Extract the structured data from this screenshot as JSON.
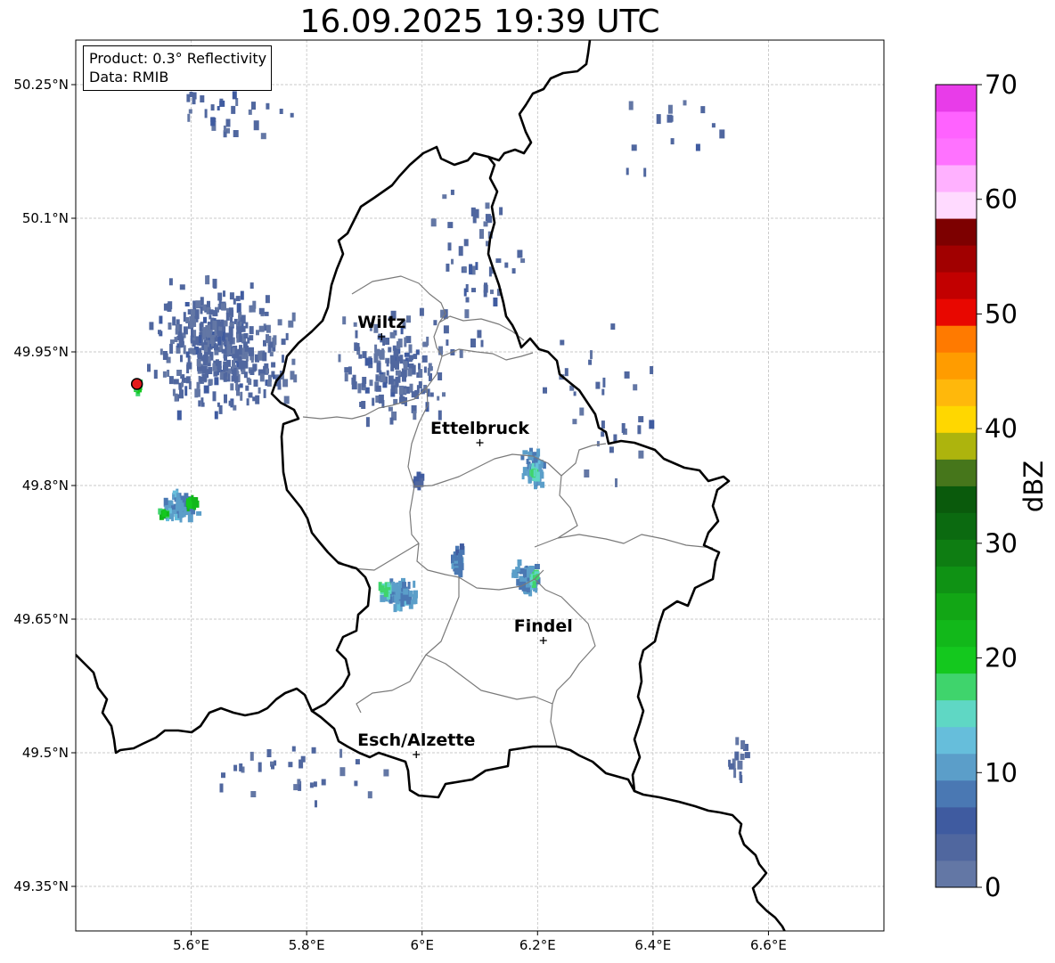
{
  "title": "16.09.2025 19:39 UTC",
  "info_box": {
    "product_line": "Product: 0.3° Reflectivity",
    "data_line": "Data: RMIB"
  },
  "map": {
    "lon_range": [
      5.4,
      6.8
    ],
    "lat_range": [
      49.3,
      50.3
    ],
    "lon_ticks": [
      {
        "value": 5.6,
        "label": "5.6°E"
      },
      {
        "value": 5.8,
        "label": "5.8°E"
      },
      {
        "value": 6.0,
        "label": "6°E"
      },
      {
        "value": 6.2,
        "label": "6.2°E"
      },
      {
        "value": 6.4,
        "label": "6.4°E"
      },
      {
        "value": 6.6,
        "label": "6.6°E"
      }
    ],
    "lat_ticks": [
      {
        "value": 50.25,
        "label": "50.25°N"
      },
      {
        "value": 50.1,
        "label": "50.1°N"
      },
      {
        "value": 49.95,
        "label": "49.95°N"
      },
      {
        "value": 49.8,
        "label": "49.8°N"
      },
      {
        "value": 49.65,
        "label": "49.65°N"
      },
      {
        "value": 49.5,
        "label": "49.5°N"
      },
      {
        "value": 49.35,
        "label": "49.35°N"
      }
    ],
    "grid": true,
    "cities": [
      {
        "name": "Wiltz",
        "lon": 5.93,
        "lat": 49.967
      },
      {
        "name": "Ettelbruck",
        "lon": 6.1,
        "lat": 49.848
      },
      {
        "name": "Findel",
        "lon": 6.21,
        "lat": 49.626
      },
      {
        "name": "Esch/Alzette",
        "lon": 5.99,
        "lat": 49.498
      }
    ],
    "radar_site": {
      "lon": 5.506,
      "lat": 49.914,
      "color": "#e41a1c"
    },
    "echo_cells": [
      {
        "lon": 6.19,
        "lat": 49.822,
        "dbz": 10,
        "clon": 0.025,
        "clat": 0.028,
        "count": 60
      },
      {
        "lon": 6.19,
        "lat": 49.817,
        "dbz": 16,
        "clon": 0.006,
        "clat": 0.012,
        "count": 12
      },
      {
        "lon": 5.96,
        "lat": 49.682,
        "dbz": 10,
        "clon": 0.035,
        "clat": 0.018,
        "count": 90
      },
      {
        "lon": 5.935,
        "lat": 49.688,
        "dbz": 16,
        "clon": 0.015,
        "clat": 0.008,
        "count": 18
      },
      {
        "lon": 6.06,
        "lat": 49.72,
        "dbz": 8,
        "clon": 0.015,
        "clat": 0.02,
        "count": 30
      },
      {
        "lon": 6.18,
        "lat": 49.698,
        "dbz": 10,
        "clon": 0.03,
        "clat": 0.022,
        "count": 60
      },
      {
        "lon": 6.19,
        "lat": 49.7,
        "dbz": 17,
        "clon": 0.01,
        "clat": 0.008,
        "count": 10
      },
      {
        "lon": 5.575,
        "lat": 49.78,
        "dbz": 10,
        "clon": 0.04,
        "clat": 0.022,
        "count": 70
      },
      {
        "lon": 5.6,
        "lat": 49.785,
        "dbz": 22,
        "clon": 0.02,
        "clat": 0.006,
        "count": 14
      },
      {
        "lon": 5.55,
        "lat": 49.772,
        "dbz": 20,
        "clon": 0.012,
        "clat": 0.005,
        "count": 8
      },
      {
        "lon": 5.505,
        "lat": 49.914,
        "dbz": 18,
        "clon": 0.007,
        "clat": 0.007,
        "count": 14
      },
      {
        "lon": 5.99,
        "lat": 49.81,
        "dbz": 5,
        "clon": 0.012,
        "clat": 0.008,
        "count": 12
      },
      {
        "lon": 5.65,
        "lat": 49.96,
        "dbz": 3,
        "clon": 0.15,
        "clat": 0.09,
        "count": 420
      },
      {
        "lon": 5.95,
        "lat": 49.93,
        "dbz": 3,
        "clon": 0.12,
        "clat": 0.08,
        "count": 160
      },
      {
        "lon": 6.1,
        "lat": 50.05,
        "dbz": 3,
        "clon": 0.12,
        "clat": 0.12,
        "count": 50
      },
      {
        "lon": 5.65,
        "lat": 50.22,
        "dbz": 3,
        "clon": 0.15,
        "clat": 0.04,
        "count": 30
      },
      {
        "lon": 6.3,
        "lat": 49.9,
        "dbz": 3,
        "clon": 0.15,
        "clat": 0.15,
        "count": 30
      },
      {
        "lon": 5.8,
        "lat": 49.48,
        "dbz": 3,
        "clon": 0.25,
        "clat": 0.05,
        "count": 30
      },
      {
        "lon": 6.55,
        "lat": 49.5,
        "dbz": 3,
        "clon": 0.03,
        "clat": 0.05,
        "count": 14
      },
      {
        "lon": 6.45,
        "lat": 50.2,
        "dbz": 3,
        "clon": 0.15,
        "clat": 0.07,
        "count": 14
      }
    ]
  },
  "colorbar": {
    "label": "dBZ",
    "min": 0,
    "max": 70,
    "ticks": [
      {
        "value": 0,
        "label": "0"
      },
      {
        "value": 10,
        "label": "10"
      },
      {
        "value": 20,
        "label": "20"
      },
      {
        "value": 30,
        "label": "30"
      },
      {
        "value": 40,
        "label": "40"
      },
      {
        "value": 50,
        "label": "50"
      },
      {
        "value": 60,
        "label": "60"
      },
      {
        "value": 70,
        "label": "70"
      }
    ],
    "colors": [
      "#6377a5",
      "#50679f",
      "#3f5ba0",
      "#4a78b3",
      "#5b9ec9",
      "#66bedb",
      "#5fd7c4",
      "#3fd46c",
      "#14c81e",
      "#12b81a",
      "#12a615",
      "#0f9214",
      "#0e7d12",
      "#0b6a10",
      "#0a5a0c",
      "#46761b",
      "#adb40d",
      "#ffd700",
      "#ffb80b",
      "#ff9c00",
      "#ff7a00",
      "#e80700",
      "#c20000",
      "#a10000",
      "#7d0000",
      "#ffdaff",
      "#ffb1ff",
      "#ff72ff",
      "#ff62ff",
      "#e83ce9"
    ]
  }
}
